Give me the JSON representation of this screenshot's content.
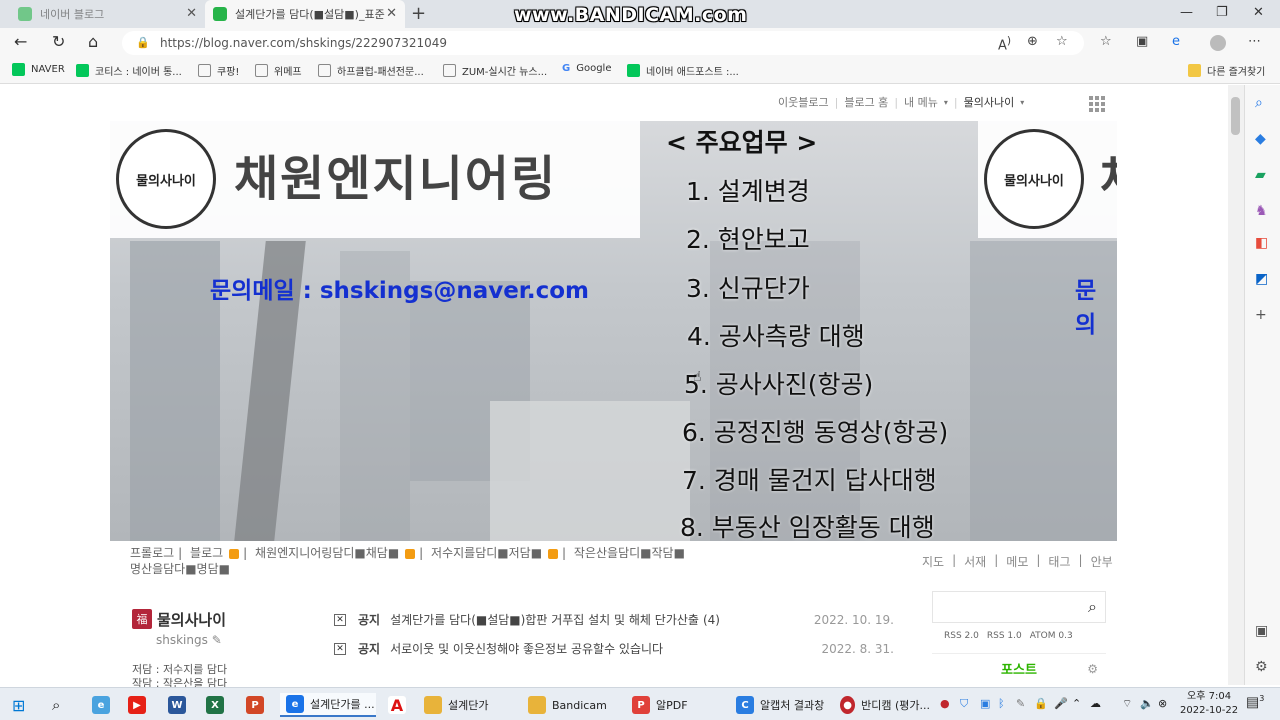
{
  "watermark": "www.BANDICAM.com",
  "tabs": [
    {
      "title": "네이버 블로그",
      "favicon_color": "#28b44a"
    },
    {
      "title": "설계단가를 담다(■설담■)_표준",
      "favicon_color": "#28b44a"
    }
  ],
  "address_bar": {
    "url": "https://blog.naver.com/shskings/222907321049"
  },
  "bookmarks": [
    {
      "label": "NAVER",
      "color": "#03c75a"
    },
    {
      "label": "코티스 : 네이버 통...",
      "color": "#03c75a"
    },
    {
      "label": "쿠팡!",
      "color": "#888888"
    },
    {
      "label": "위메프",
      "color": "#888888"
    },
    {
      "label": "하프클럽-패션전문...",
      "color": "#888888"
    },
    {
      "label": "ZUM-실시간 뉴스...",
      "color": "#888888"
    },
    {
      "label": "Google",
      "color": "#4285f4"
    },
    {
      "label": "네이버 애드포스트 :...",
      "color": "#03c75a"
    }
  ],
  "other_bookmarks": "다른 즐겨찾기",
  "blog_topnav": [
    "이웃블로그",
    "블로그 홈",
    "내 메뉴",
    "물의사나이"
  ],
  "banner": {
    "logo_text": "물의사나이",
    "company": "채원엔지니어링",
    "company_partial": "채",
    "email_line": "문의메일 : shskings@naver.com",
    "email_partial": "문의",
    "duties_title": "< 주요업무 >",
    "duties": [
      "1. 설계변경",
      "2. 현안보고",
      "3. 신규단가",
      "4. 공사측량 대행",
      "5. 공사사진(항공)",
      "6. 공정진행 동영상(항공)",
      "7. 경매 물건지 답사대행",
      "8. 부동산 임장활동 대행"
    ]
  },
  "categories_line1": [
    "프롤로그",
    "블로그",
    "채원엔지니어링담디■채담■",
    "저수지를담디■저담■",
    "작은산을담디■작담■"
  ],
  "categories_line2": "명산을담다■명담■",
  "right_nav": [
    "지도",
    "서재",
    "메모",
    "태그",
    "안부"
  ],
  "profile": {
    "name": "물의사나이",
    "id": "shskings",
    "lines": [
      "저담 : 저수지를 담다",
      "작담 : 작은산을 담다"
    ]
  },
  "notices": [
    {
      "label": "공지",
      "title": "설계단가를 담다(■설담■)합판 거푸집 설치 및 해체 단가산출",
      "count": "(4)",
      "date": "2022. 10. 19."
    },
    {
      "label": "공지",
      "title": "서로이웃 및 이웃신청해야 좋은정보 공유할수 있습니다",
      "count": "",
      "date": "2022. 8. 31."
    }
  ],
  "rss": [
    "RSS 2.0",
    "RSS 1.0",
    "ATOM 0.3"
  ],
  "posts_label": "포스트",
  "taskbar": [
    {
      "label": "설계단가를 ...",
      "color": "#1a73e8"
    },
    {
      "label": "설계단가",
      "color": "#e8b33a"
    },
    {
      "label": "Bandicam",
      "color": "#e8b33a"
    },
    {
      "label": "알PDF",
      "color": "#e0413a"
    },
    {
      "label": "알캡처 결과창",
      "color": "#2a7de1"
    },
    {
      "label": "반디캠 (평가...",
      "color": "#c0272d"
    }
  ],
  "clock": {
    "ampm_time": "오후 7:04",
    "date": "2022-10-22"
  },
  "notification_count": "3"
}
